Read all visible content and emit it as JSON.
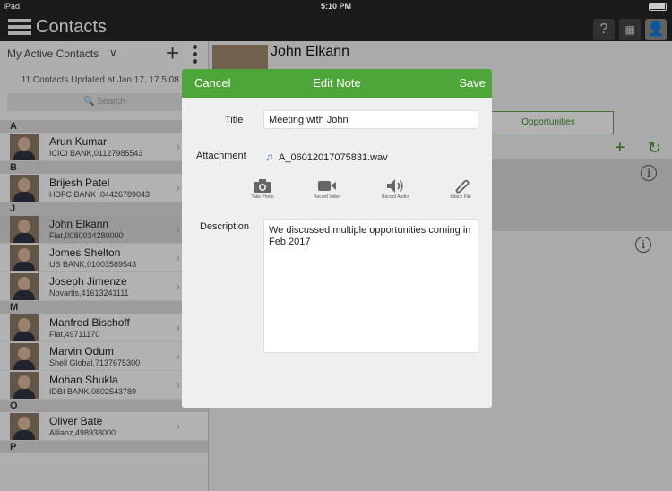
{
  "status": {
    "carrier": "iPad",
    "time": "5:10 PM"
  },
  "app": {
    "title": "Contacts"
  },
  "sidebar": {
    "filter": "My Active Contacts",
    "updated": "11 Contacts Updated at Jan 17, 17 5:08 P",
    "search_placeholder": "Search",
    "sections": [
      {
        "letter": "A",
        "contacts": [
          {
            "name": "Arun Kumar",
            "sub": "ICICI BANK,01127985543"
          }
        ]
      },
      {
        "letter": "B",
        "contacts": [
          {
            "name": "Brijesh Patel",
            "sub": "HDFC BANK ,04426789043"
          }
        ]
      },
      {
        "letter": "J",
        "contacts": [
          {
            "name": "John Elkann",
            "sub": "Fiat,0080034280000"
          },
          {
            "name": "Jomes Shelton",
            "sub": "US BANK,01003589543"
          },
          {
            "name": "Joseph Jimenze",
            "sub": "Novartis,41613241111"
          }
        ]
      },
      {
        "letter": "M",
        "contacts": [
          {
            "name": "Manfred Bischoff",
            "sub": "Fiat,49711170"
          },
          {
            "name": "Marvin Odum",
            "sub": "Shell Global,7137675300"
          },
          {
            "name": "Mohan Shukla",
            "sub": "IDBI BANK,0802543789"
          }
        ]
      },
      {
        "letter": "O",
        "contacts": [
          {
            "name": "Oliver Bate",
            "sub": "Allianz,498938000"
          }
        ]
      },
      {
        "letter": "P",
        "contacts": []
      }
    ]
  },
  "detail": {
    "name": "John Elkann",
    "opportunities_tab": "Opportunities"
  },
  "modal": {
    "cancel": "Cancel",
    "title": "Edit Note",
    "save": "Save",
    "title_label": "Title",
    "title_value": "Meeting with John",
    "attachment_label": "Attachment",
    "attachment_file": "A_06012017075831.wav",
    "actions": [
      "Take Photo",
      "Record Video",
      "Record Audio",
      "Attach File"
    ],
    "description_label": "Description",
    "description_value": "We discussed multiple opportunities coming in Feb 2017"
  }
}
